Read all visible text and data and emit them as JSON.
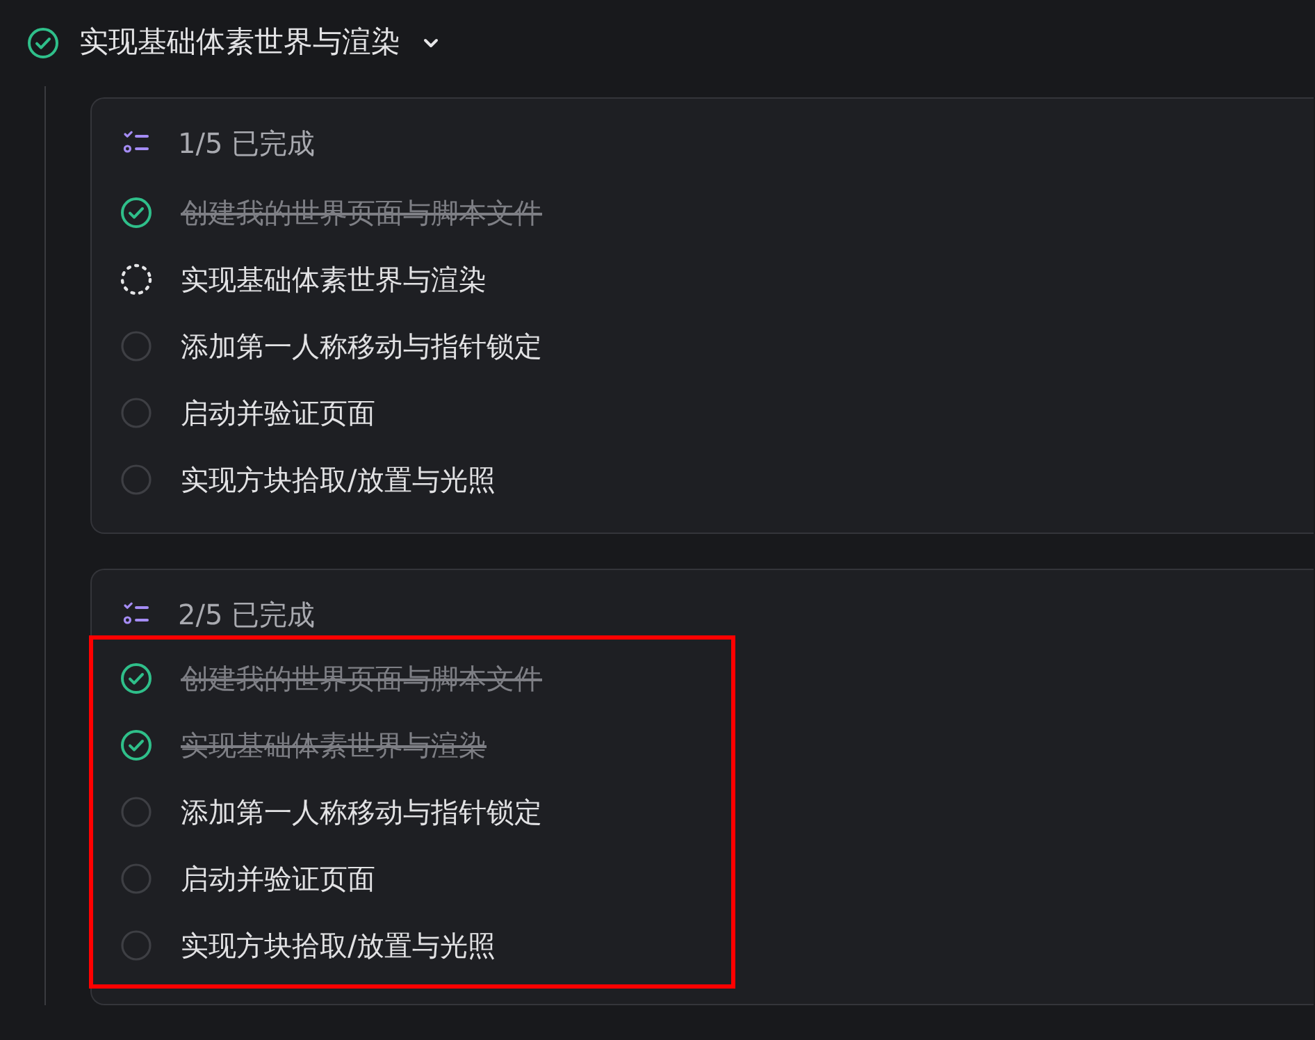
{
  "task": {
    "title": "实现基础体素世界与渲染",
    "done": true,
    "expanded": true
  },
  "checklists": [
    {
      "progress": "1/5 已完成",
      "highlighted": false,
      "items": [
        {
          "label": "创建我的世界页面与脚本文件",
          "kind": "done"
        },
        {
          "label": "实现基础体素世界与渲染",
          "kind": "in_progress"
        },
        {
          "label": "添加第一人称移动与指针锁定",
          "kind": "pending"
        },
        {
          "label": "启动并验证页面",
          "kind": "pending"
        },
        {
          "label": "实现方块拾取/放置与光照",
          "kind": "pending"
        }
      ]
    },
    {
      "progress": "2/5 已完成",
      "highlighted": true,
      "items": [
        {
          "label": "创建我的世界页面与脚本文件",
          "kind": "done"
        },
        {
          "label": "实现基础体素世界与渲染",
          "kind": "done"
        },
        {
          "label": "添加第一人称移动与指针锁定",
          "kind": "pending"
        },
        {
          "label": "启动并验证页面",
          "kind": "pending"
        },
        {
          "label": "实现方块拾取/放置与光照",
          "kind": "pending"
        }
      ]
    }
  ]
}
